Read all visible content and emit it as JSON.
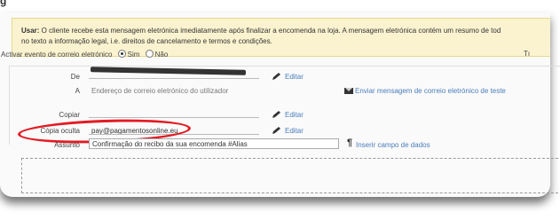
{
  "header_fragment": "g",
  "info": {
    "prefix": "Usar:",
    "line1": " O cliente recebe esta mensagem eletrónica imediatamente após finalizar a encomenda na loja. A mensagem eletrónica contém um resumo de tod",
    "line2": "no texto a informação legal, i.e. direitos de cancelamento e termos e condições."
  },
  "activate": {
    "label": "Activar evento de correio eletrónico",
    "yes": "Sim",
    "no": "Não",
    "selected": "Sim",
    "cut_right": "Tı"
  },
  "form": {
    "from_label": "De",
    "from_edit": "Editar",
    "address_prefix": "A",
    "address_placeholder": "Endereço de correio eletrónico do utilizador",
    "test_email_link": "Enviar mensagem de correio eletrónico de teste",
    "copy_label": "Copiar",
    "copy_edit": "Editar",
    "bcc_label": "Cópia oculta",
    "bcc_value": "pay@pagamentosonline.eu",
    "bcc_edit": "Editar",
    "subject_label": "Assunto",
    "subject_value": "Confirmação do recibo da sua encomenda #Alias",
    "insert_field_link": "Inserir campo de dados"
  },
  "icons": {
    "pencil": "pencil-icon",
    "envelope": "envelope-icon",
    "pilcrow": "paragraph-icon"
  },
  "colors": {
    "info_bg": "#fbf3cf",
    "link": "#4a7dbb",
    "highlight": "#e31b23"
  }
}
